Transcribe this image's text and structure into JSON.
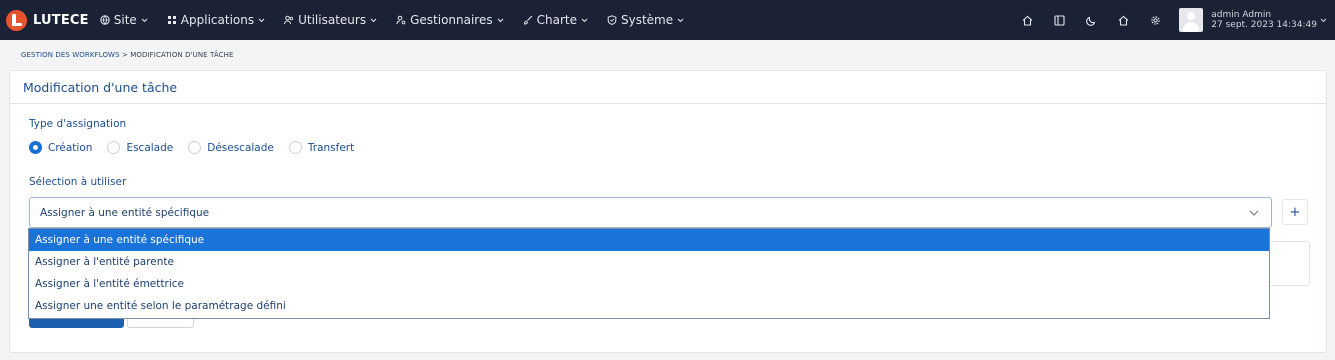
{
  "navbar": {
    "brand": "LUTECE",
    "menu": [
      {
        "label": "Site",
        "icon": "globe-icon"
      },
      {
        "label": "Applications",
        "icon": "grid-icon"
      },
      {
        "label": "Utilisateurs",
        "icon": "users-icon"
      },
      {
        "label": "Gestionnaires",
        "icon": "user-cog-icon"
      },
      {
        "label": "Charte",
        "icon": "brush-icon"
      },
      {
        "label": "Système",
        "icon": "shield-icon"
      }
    ],
    "right_icons": [
      "home-icon",
      "layout-icon",
      "moon-icon",
      "home-icon",
      "gear-icon"
    ],
    "user": {
      "name": "admin Admin",
      "datetime": "27 sept. 2023 14:34:49"
    }
  },
  "breadcrumb": {
    "parent": "GESTION DES WORKFLOWS",
    "separator": ">",
    "current": "MODIFICATION D'UNE TÂCHE"
  },
  "card": {
    "title": "Modification d'une tâche",
    "assignment_type_label": "Type d'assignation",
    "assignment_types": [
      {
        "label": "Création",
        "checked": true
      },
      {
        "label": "Escalade",
        "checked": false
      },
      {
        "label": "Désescalade",
        "checked": false
      },
      {
        "label": "Transfert",
        "checked": false
      }
    ],
    "selection_label": "Sélection à utiliser",
    "selection_value": "Assigner à une entité spécifique",
    "add_label": "+",
    "options": [
      "Assigner à une entité spécifique",
      "Assigner à l'entité parente",
      "Assigner à l'entité émettrice",
      "Assigner une entité selon le paramétrage défini"
    ],
    "selected_option_index": 0
  },
  "colors": {
    "navbar": "#1b2236",
    "accent": "#1a73d9",
    "text_link": "#1d4e8f",
    "logo": "#e8542d"
  }
}
